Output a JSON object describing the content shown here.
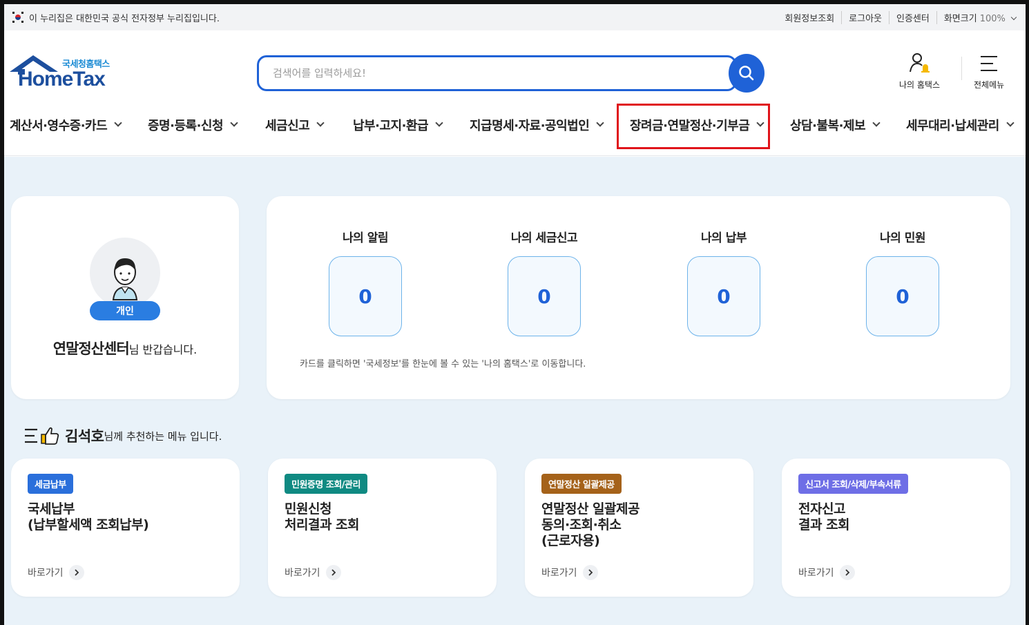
{
  "govbar": {
    "notice": "이 누리집은 대한민국 공식 전자정부 누리집입니다.",
    "links": [
      "회원정보조회",
      "로그아웃",
      "인증센터"
    ],
    "zoom_label": "화면크기",
    "zoom_value": "100%"
  },
  "header": {
    "logo_sub": "국세청홈택스",
    "logo_main": "HomeTax",
    "search_placeholder": "검색어를 입력하세요!",
    "my_hometax": "나의 홈택스",
    "all_menu": "전체메뉴"
  },
  "nav": {
    "items": [
      "계산서·영수증·카드",
      "증명·등록·신청",
      "세금신고",
      "납부·고지·환급",
      "지급명세·자료·공익법인",
      "장려금·연말정산·기부금",
      "상담·불복·제보",
      "세무대리·납세관리"
    ]
  },
  "profile": {
    "badge": "개인",
    "name": "연말정산센터",
    "greeting": "님 반갑습니다."
  },
  "stats": {
    "items": [
      {
        "label": "나의 알림",
        "value": "0"
      },
      {
        "label": "나의 세금신고",
        "value": "0"
      },
      {
        "label": "나의 납부",
        "value": "0"
      },
      {
        "label": "나의 민원",
        "value": "0"
      }
    ],
    "hint": "카드를 클릭하면 '국세정보'를 한눈에 볼 수 있는 '나의 홈택스'로 이동합니다."
  },
  "recommend": {
    "name": "김석호",
    "suffix": "님께 추천하는 메뉴 입니다.",
    "cards": [
      {
        "tag": "세금납부",
        "tag_color": "#2a6fdb",
        "title": "국세납부\n(납부할세액 조회납부)",
        "go": "바로가기"
      },
      {
        "tag": "민원증명 조회/관리",
        "tag_color": "#0f8a82",
        "title": "민원신청\n처리결과 조회",
        "go": "바로가기"
      },
      {
        "tag": "연말정산 일괄제공",
        "tag_color": "#a5621a",
        "title": "연말정산 일괄제공\n동의·조회·취소\n(근로자용)",
        "go": "바로가기"
      },
      {
        "tag": "신고서 조회/삭제/부속서류",
        "tag_color": "#6e6ee6",
        "title": "전자신고\n결과 조회",
        "go": "바로가기"
      }
    ]
  }
}
